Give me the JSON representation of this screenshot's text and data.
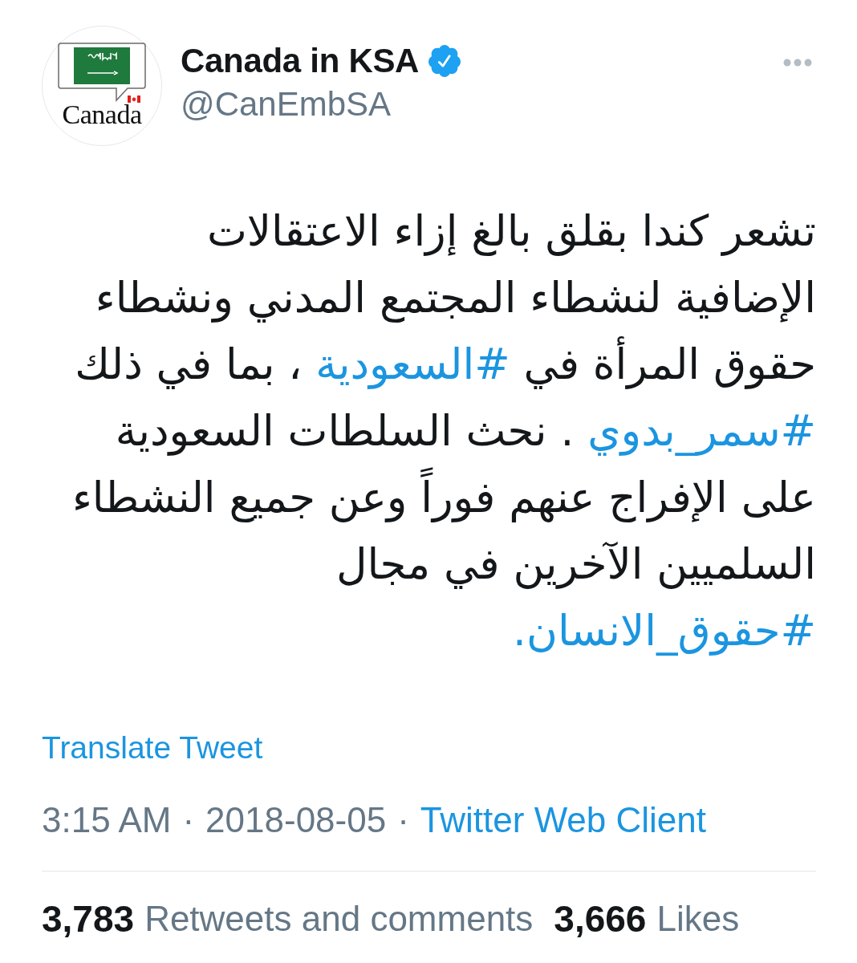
{
  "author": {
    "avatar": {
      "wordmark": "Canada"
    },
    "name": "Canada in KSA",
    "verified": true,
    "handle": "@CanEmbSA"
  },
  "tweet": {
    "body": [
      {
        "kind": "text",
        "text": "تشعر كندا بقلق بالغ إزاء الاعتقالات الإضافية لنشطاء المجتمع المدني ونشطاء حقوق المرأة في "
      },
      {
        "kind": "hashtag",
        "text": "#السعودية"
      },
      {
        "kind": "text",
        "text": " ، بما في ذلك "
      },
      {
        "kind": "hashtag",
        "text": "#سمر_بدوي"
      },
      {
        "kind": "text",
        "text": " . نحث السلطات السعودية على الإفراج عنهم فوراً وعن جميع النشطاء السلميين الآخرين في مجال "
      },
      {
        "kind": "hashtag",
        "text": "#حقوق_الانسان."
      }
    ],
    "translate_label": "Translate Tweet",
    "meta": {
      "time": "3:15 AM",
      "separator_1": "·",
      "date": "2018-08-05",
      "separator_2": "·",
      "source": "Twitter Web Client"
    }
  },
  "stats": {
    "retweets": {
      "count": "3,783",
      "label": "Retweets and comments"
    },
    "likes": {
      "count": "3,666",
      "label": "Likes"
    }
  }
}
